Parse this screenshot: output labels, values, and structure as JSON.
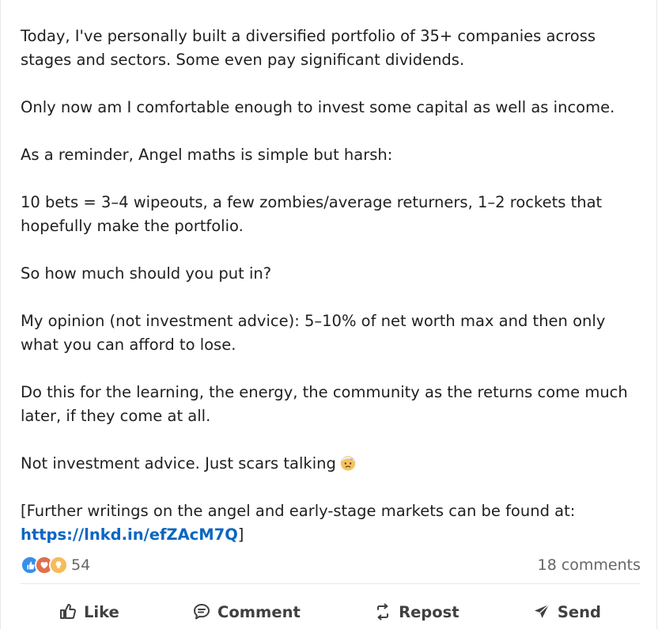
{
  "post": {
    "p1": "Today, I've personally built a diversified portfolio of 35+ companies across stages and sectors. Some even pay significant dividends.",
    "p2": "Only now am I comfortable enough to invest some capital as well as income.",
    "p3": "As a reminder, Angel maths is simple but harsh:",
    "p4": "10 bets = 3–4 wipeouts, a few zombies/average returners, 1–2 rockets that hopefully make the portfolio.",
    "p5": "So how much should you put in?",
    "p6": "My opinion (not investment advice): 5–10% of net worth max and then only what you can afford to lose.",
    "p7": "Do this for the learning, the energy, the community as the returns come much later, if they come at all.",
    "p8": "Not investment advice. Just scars talking",
    "p8_emoji": "face-with-head-bandage-icon",
    "p9_prefix": "[Further writings on the angel and early-stage markets can be found at: ",
    "p9_link": "https://lnkd.in/efZAcM7Q",
    "p9_suffix": "]"
  },
  "social": {
    "reaction_icons": [
      "like-icon",
      "love-icon",
      "insightful-icon"
    ],
    "reaction_count": "54",
    "comments": "18 comments"
  },
  "actions": {
    "like": "Like",
    "comment": "Comment",
    "repost": "Repost",
    "send": "Send"
  },
  "colors": {
    "link": "#0a66c2",
    "like_blue": "#378fe9",
    "love_red": "#df704d",
    "insightful_yellow": "#f5bb5c",
    "muted_text": "#666666",
    "action_text": "#404040"
  }
}
